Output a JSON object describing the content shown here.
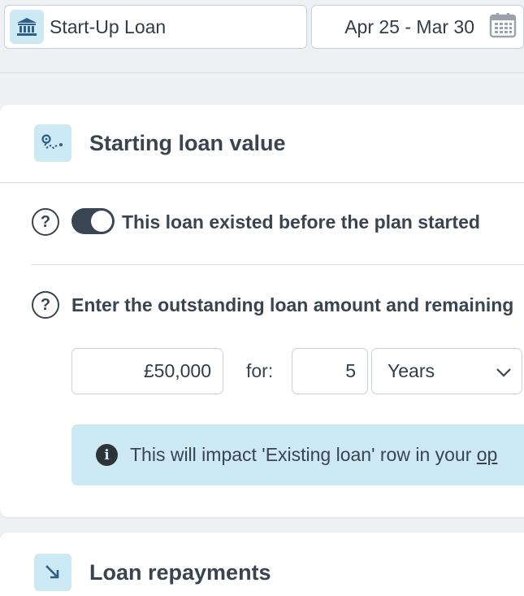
{
  "header": {
    "loan_name": "Start-Up Loan",
    "loan_icon": "bank-icon",
    "date_range": "Apr 25 - Mar 30",
    "date_icon": "calendar-icon"
  },
  "starting_loan": {
    "title": "Starting loan value",
    "icon": "route-icon",
    "toggle_label": "This loan existed before the plan started",
    "toggle_on": true,
    "help_glyph": "?",
    "instruction": "Enter the outstanding loan amount and remaining",
    "amount_value": "£50,000",
    "for_label": "for:",
    "term_value": "5",
    "term_unit": "Years",
    "info_glyph": "i",
    "info_text": "This will impact 'Existing loan' row in your ",
    "info_link": "op"
  },
  "repayments": {
    "title": "Loan repayments",
    "icon": "arrow-down-right-icon"
  },
  "colors": {
    "accent_badge": "#cdeaf4",
    "toggle_on": "#3a4654",
    "background": "#eef1f4"
  }
}
